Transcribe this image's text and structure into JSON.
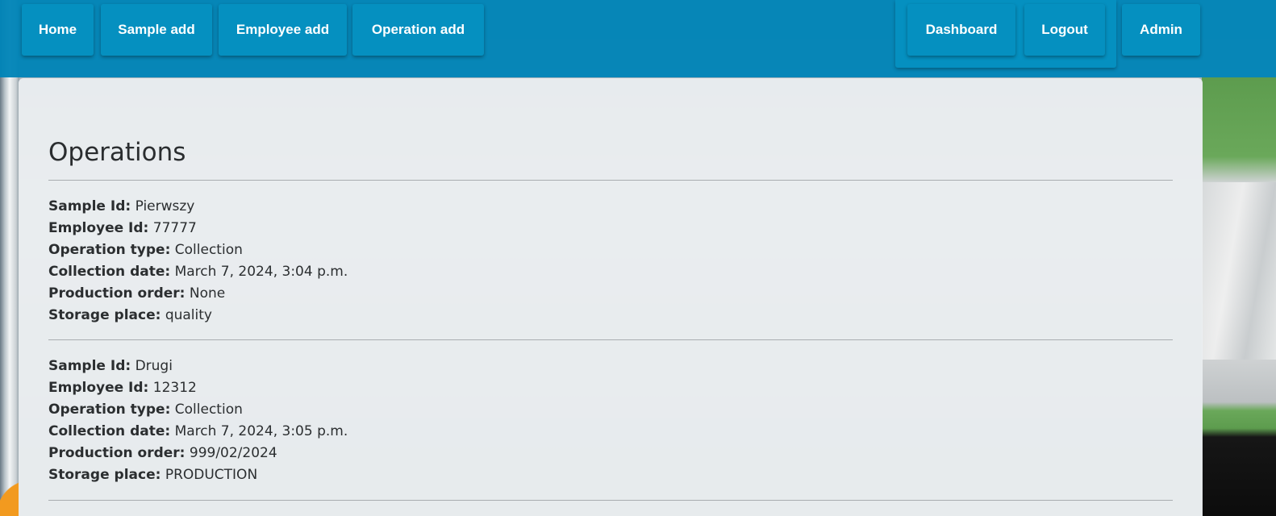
{
  "nav": {
    "left": [
      {
        "label": "Home"
      },
      {
        "label": "Sample add"
      },
      {
        "label": "Employee add"
      },
      {
        "label": "Operation add"
      }
    ],
    "right": [
      {
        "label": "Dashboard"
      },
      {
        "label": "Logout"
      },
      {
        "label": "Admin"
      }
    ]
  },
  "main": {
    "title": "Operations",
    "field_labels": {
      "sample_id": "Sample Id:",
      "employee_id": "Employee Id:",
      "operation_type": "Operation type:",
      "collection_date": "Collection date:",
      "production_order": "Production order:",
      "storage_place": "Storage place:"
    },
    "operations": [
      {
        "sample_id": "Pierwszy",
        "employee_id": "77777",
        "operation_type": "Collection",
        "collection_date": "March 7, 2024, 3:04 p.m.",
        "production_order": "None",
        "storage_place": "quality"
      },
      {
        "sample_id": "Drugi",
        "employee_id": "12312",
        "operation_type": "Collection",
        "collection_date": "March 7, 2024, 3:05 p.m.",
        "production_order": "999/02/2024",
        "storage_place": "PRODUCTION"
      }
    ]
  },
  "colors": {
    "navbar": "#0084b7",
    "nav_button": "#0590c0",
    "panel": "#eceff1"
  }
}
